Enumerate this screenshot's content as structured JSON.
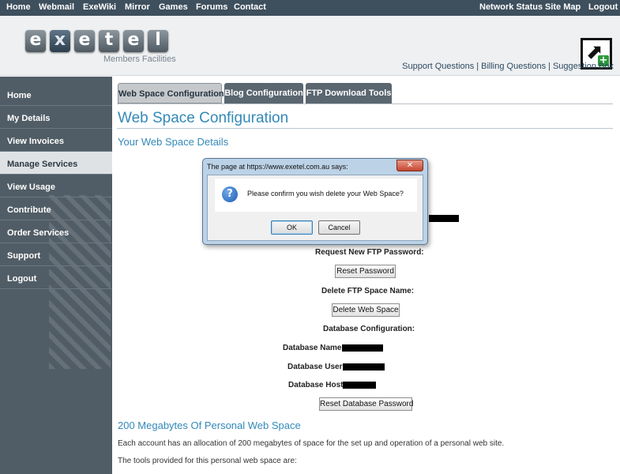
{
  "topnav": {
    "left": [
      "Home",
      "Webmail",
      "ExeWiki",
      "Mirror",
      "Games",
      "Forums",
      "Contact"
    ],
    "right": [
      "Network Status",
      "Site Map",
      "Logout"
    ]
  },
  "header": {
    "logo_letters": [
      "e",
      "x",
      "e",
      "t",
      "e",
      "l"
    ],
    "logo_subtitle": "Members Facilities",
    "support_links": [
      "Support Questions",
      "Billing Questions",
      "Suggestion Box"
    ]
  },
  "sidebar": {
    "items": [
      "Home",
      "My Details",
      "View Invoices",
      "Manage Services",
      "View Usage",
      "Contribute",
      "Order Services",
      "Support",
      "Logout"
    ],
    "active": "Manage Services"
  },
  "tabs": [
    "Web Space Configuration",
    "Blog Configuration",
    "FTP Download Tools"
  ],
  "main": {
    "title": "Web Space Configuration",
    "details_heading": "Your Web Space Details",
    "request_ftp_label": "Request New FTP Password:",
    "reset_password_button": "Reset Password",
    "delete_ftp_label": "Delete FTP Space Name:",
    "delete_web_space_button": "Delete Web Space",
    "db_config_label": "Database Configuration:",
    "db_name_label": "Database Name:",
    "db_user_label": "Database User:",
    "db_host_label": "Database Host:",
    "reset_db_password_button": "Reset Database Password",
    "personal_heading": "200 Megabytes Of Personal Web Space",
    "para1": "Each account has an allocation of 200 megabytes of space for the set up and operation of a personal web site.",
    "para2": "The tools provided for this personal web space are:"
  },
  "dialog": {
    "title": "The page at https://www.exetel.com.au says:",
    "close_glyph": "✕",
    "icon_glyph": "?",
    "message": "Please confirm you wish delete your Web Space?",
    "ok": "OK",
    "cancel": "Cancel"
  }
}
